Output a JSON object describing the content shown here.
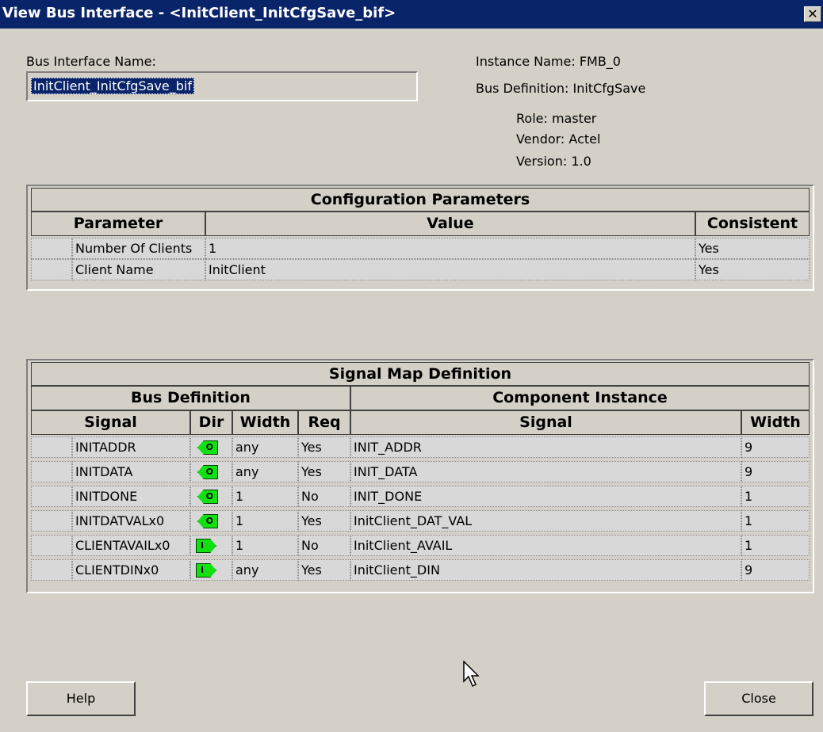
{
  "window": {
    "title": "View Bus Interface - <InitClient_InitCfgSave_bif>",
    "close_glyph": "✕"
  },
  "bus_interface": {
    "label": "Bus Interface Name:",
    "value": "InitClient_InitCfgSave_bif"
  },
  "info": {
    "instance": "Instance Name: FMB_0",
    "bus_def": "Bus Definition: InitCfgSave",
    "role": "Role: master",
    "vendor": "Vendor: Actel",
    "version": "Version: 1.0"
  },
  "config": {
    "title": "Configuration Parameters",
    "headers": [
      "Parameter",
      "Value",
      "Consistent"
    ],
    "rows": [
      [
        "Number Of Clients",
        "1",
        "Yes"
      ],
      [
        "Client Name",
        "InitClient",
        "Yes"
      ]
    ]
  },
  "signal_map": {
    "title": "Signal Map Definition",
    "group_bus": "Bus Definition",
    "group_comp": "Component Instance",
    "headers": [
      "Signal",
      "Dir",
      "Width",
      "Req",
      "Signal",
      "Width"
    ],
    "rows": [
      {
        "signal": "INITADDR",
        "dir": "O",
        "width": "any",
        "req": "Yes",
        "comp_signal": "INIT_ADDR",
        "comp_width": "9"
      },
      {
        "signal": "INITDATA",
        "dir": "O",
        "width": "any",
        "req": "Yes",
        "comp_signal": "INIT_DATA",
        "comp_width": "9"
      },
      {
        "signal": "INITDONE",
        "dir": "O",
        "width": "1",
        "req": "No",
        "comp_signal": "INIT_DONE",
        "comp_width": "1"
      },
      {
        "signal": "INITDATVALx0",
        "dir": "O",
        "width": "1",
        "req": "Yes",
        "comp_signal": "InitClient_DAT_VAL",
        "comp_width": "1"
      },
      {
        "signal": "CLIENTAVAILx0",
        "dir": "I",
        "width": "1",
        "req": "No",
        "comp_signal": "InitClient_AVAIL",
        "comp_width": "1"
      },
      {
        "signal": "CLIENTDINx0",
        "dir": "I",
        "width": "any",
        "req": "Yes",
        "comp_signal": "InitClient_DIN",
        "comp_width": "9"
      }
    ]
  },
  "buttons": {
    "help": "Help",
    "close": "Close"
  },
  "colors": {
    "title_bar": "#0a246a",
    "dialog": "#d4d0c8",
    "pin": "#11e011"
  }
}
